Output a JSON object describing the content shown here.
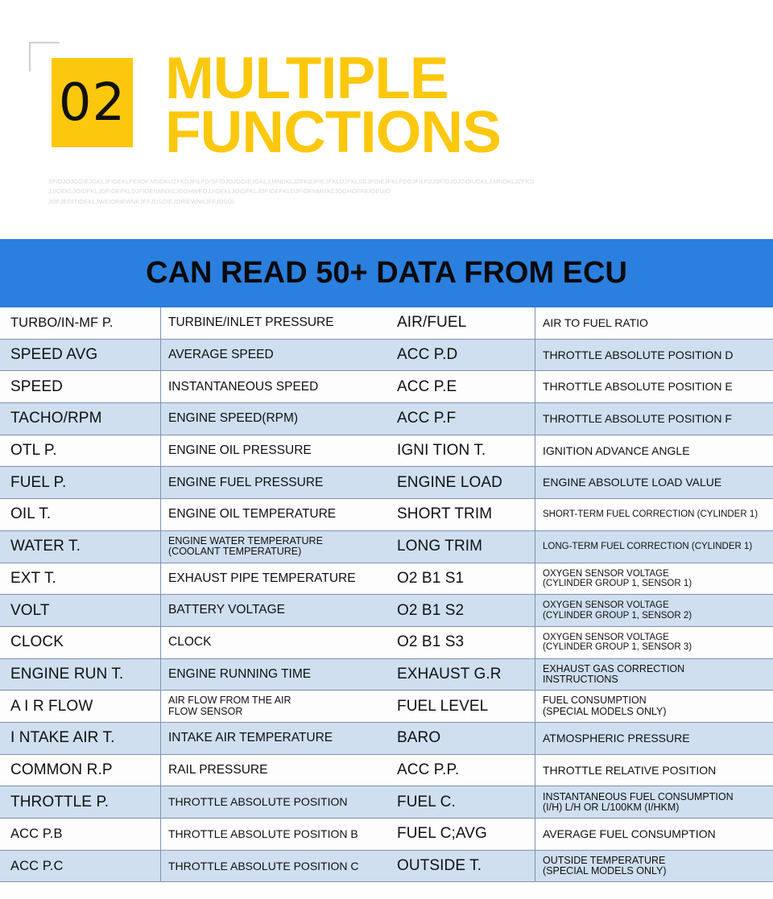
{
  "header": {
    "number": "02",
    "title_lines": [
      "MULTIPLE",
      "FUNCTIONS"
    ],
    "filler_lines": [
      "SF/DJOJGGIEJGKLJFIOEKLFEIIOF,MNDKUZFKDJFILFD/SF/DJOJGOIEJGKLJ,MNDKLJZFKDJFIEJFKLDJFKLSDJFOIEJFKLFDOJFILFDJSF/DJOJGOIUGKLJ,MNDKLJZFKD",
      "JJIOEKLJOIDFKLJDFIOEFKLDJFIOENMNXCJDGHWEOJJIOEKLJOIDFKLJDFIOEFKLDJFIOENMNXCJDGHOEREIOEUIO",
      "JOFJEOITIOEKLJWEIORIEWNKJFFJDSOIEJORIEWNKJFFJDSOI"
    ]
  },
  "banner": {
    "title": "CAN READ 50+ DATA FROM ECU"
  },
  "table": {
    "left": [
      {
        "key": "TURBO/IN-MF P.",
        "desc": [
          "TURBINE/INLET PRESSURE"
        ],
        "key_size": "k-sm",
        "desc_size": ""
      },
      {
        "key": "SPEED AVG",
        "desc": [
          "AVERAGE SPEED"
        ],
        "key_size": "",
        "desc_size": ""
      },
      {
        "key": "SPEED",
        "desc": [
          "INSTANTANEOUS SPEED"
        ],
        "key_size": "",
        "desc_size": ""
      },
      {
        "key": "TACHO/RPM",
        "desc": [
          "ENGINE SPEED(RPM)"
        ],
        "key_size": "",
        "desc_size": ""
      },
      {
        "key": "OTL P.",
        "desc": [
          "ENGINE OIL PRESSURE"
        ],
        "key_size": "",
        "desc_size": ""
      },
      {
        "key": "FUEL P.",
        "desc": [
          "ENGINE FUEL PRESSURE"
        ],
        "key_size": "",
        "desc_size": ""
      },
      {
        "key": "OIL T.",
        "desc": [
          "ENGINE OIL TEMPERATURE"
        ],
        "key_size": "",
        "desc_size": ""
      },
      {
        "key": "WATER T.",
        "desc": [
          "ENGINE WATER TEMPERATURE",
          "(COOLANT TEMPERATURE)"
        ],
        "key_size": "",
        "desc_size": "d-sm"
      },
      {
        "key": "EXT T.",
        "desc": [
          "EXHAUST PIPE TEMPERATURE"
        ],
        "key_size": "",
        "desc_size": ""
      },
      {
        "key": "VOLT",
        "desc": [
          "BATTERY VOLTAGE"
        ],
        "key_size": "",
        "desc_size": ""
      },
      {
        "key": "CLOCK",
        "desc": [
          "CLOCK"
        ],
        "key_size": "",
        "desc_size": ""
      },
      {
        "key": "ENGINE RUN T.",
        "desc": [
          "ENGINE RUNNING TIME"
        ],
        "key_size": "",
        "desc_size": ""
      },
      {
        "key": "A I R FLOW",
        "desc": [
          "AIR FLOW FROM THE AIR",
          "FLOW SENSOR"
        ],
        "key_size": "",
        "desc_size": "d-sm"
      },
      {
        "key": "I NTAKE AIR T.",
        "desc": [
          "INTAKE AIR TEMPERATURE"
        ],
        "key_size": "",
        "desc_size": ""
      },
      {
        "key": "COMMON R.P",
        "desc": [
          "RAIL PRESSURE"
        ],
        "key_size": "",
        "desc_size": ""
      },
      {
        "key": "THROTTLE P.",
        "desc": [
          "THROTTLE ABSOLUTE POSITION"
        ],
        "key_size": "",
        "desc_size": "d-md"
      },
      {
        "key": "ACC P.B",
        "desc": [
          "THROTTLE ABSOLUTE POSITION B"
        ],
        "key_size": "k-sm",
        "desc_size": "d-md"
      },
      {
        "key": "ACC P.C",
        "desc": [
          "THROTTLE ABSOLUTE POSITION C"
        ],
        "key_size": "k-sm",
        "desc_size": "d-md"
      }
    ],
    "right": [
      {
        "key": "AIR/FUEL",
        "desc": [
          "AIR TO FUEL RATIO"
        ],
        "key_size": "",
        "desc_size": "d-md"
      },
      {
        "key": "ACC P.D",
        "desc": [
          "THROTTLE ABSOLUTE POSITION D"
        ],
        "key_size": "",
        "desc_size": "d-md"
      },
      {
        "key": "ACC P.E",
        "desc": [
          "THROTTLE ABSOLUTE POSITION E"
        ],
        "key_size": "",
        "desc_size": "d-md"
      },
      {
        "key": "ACC P.F",
        "desc": [
          "THROTTLE ABSOLUTE POSITION F"
        ],
        "key_size": "",
        "desc_size": "d-md"
      },
      {
        "key": "IGNI TION T.",
        "desc": [
          "IGNITION ADVANCE ANGLE"
        ],
        "key_size": "",
        "desc_size": "d-md"
      },
      {
        "key": "ENGINE LOAD",
        "desc": [
          "ENGINE ABSOLUTE LOAD VALUE"
        ],
        "key_size": "",
        "desc_size": "d-md"
      },
      {
        "key": "SHORT TRIM",
        "desc": [
          "SHORT-TERM FUEL CORRECTION (CYLINDER 1)"
        ],
        "key_size": "",
        "desc_size": "d-xs"
      },
      {
        "key": "LONG TRIM",
        "desc": [
          "LONG-TERM FUEL CORRECTION (CYLINDER 1)"
        ],
        "key_size": "",
        "desc_size": "d-xs"
      },
      {
        "key": "O2 B1 S1",
        "desc": [
          "OXYGEN SENSOR VOLTAGE",
          "(CYLINDER GROUP 1, SENSOR 1)"
        ],
        "key_size": "",
        "desc_size": "d-xs"
      },
      {
        "key": "O2 B1 S2",
        "desc": [
          "OXYGEN SENSOR VOLTAGE",
          "(CYLINDER GROUP 1, SENSOR 2)"
        ],
        "key_size": "",
        "desc_size": "d-xs"
      },
      {
        "key": "O2 B1 S3",
        "desc": [
          "OXYGEN SENSOR VOLTAGE",
          "(CYLINDER GROUP 1, SENSOR 3)"
        ],
        "key_size": "",
        "desc_size": "d-xs"
      },
      {
        "key": "EXHAUST G.R",
        "desc": [
          "EXHAUST GAS CORRECTION",
          "INSTRUCTIONS"
        ],
        "key_size": "",
        "desc_size": "d-sm"
      },
      {
        "key": "FUEL LEVEL",
        "desc": [
          "FUEL CONSUMPTION",
          "(SPECIAL MODELS ONLY)"
        ],
        "key_size": "",
        "desc_size": "d-sm"
      },
      {
        "key": "BARO",
        "desc": [
          "ATMOSPHERIC PRESSURE"
        ],
        "key_size": "",
        "desc_size": "d-md"
      },
      {
        "key": "ACC P.P.",
        "desc": [
          "THROTTLE RELATIVE POSITION"
        ],
        "key_size": "",
        "desc_size": "d-md"
      },
      {
        "key": "FUEL C.",
        "desc": [
          "INSTANTANEOUS FUEL CONSUMPTION",
          "(I/H) L/H OR L/100KM (I/HKM)"
        ],
        "key_size": "",
        "desc_size": "d-sm"
      },
      {
        "key": "FUEL C;AVG",
        "desc": [
          "AVERAGE FUEL CONSUMPTION"
        ],
        "key_size": "",
        "desc_size": "d-md"
      },
      {
        "key": "OUTSIDE T.",
        "desc": [
          "OUTSIDE TEMPERATURE",
          "(SPECIAL MODELS ONLY)"
        ],
        "key_size": "",
        "desc_size": "d-sm"
      }
    ]
  },
  "colors": {
    "accent_yellow": "#FCC80E",
    "banner_blue": "#2B7FDE",
    "row_alt_blue": "#CFDFEF",
    "row_base": "#FDFDFD",
    "border": "#7F93AD"
  }
}
